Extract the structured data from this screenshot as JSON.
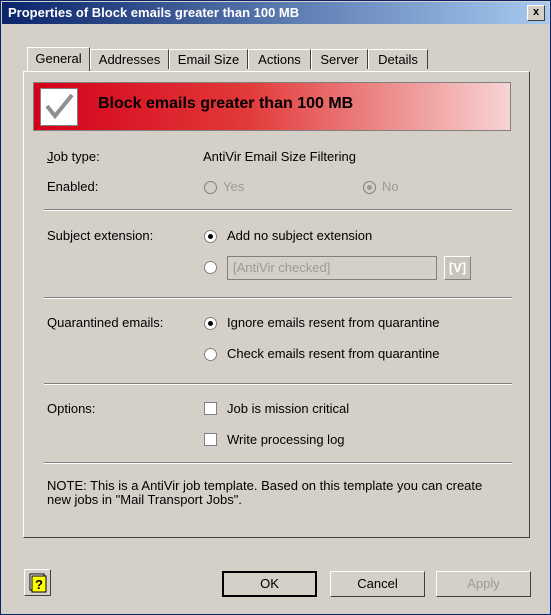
{
  "window": {
    "title": "Properties of Block emails greater than 100 MB",
    "close_glyph": "x"
  },
  "tabs": [
    {
      "label": "General",
      "active": true
    },
    {
      "label": "Addresses"
    },
    {
      "label": "Email Size"
    },
    {
      "label": "Actions"
    },
    {
      "label": "Server"
    },
    {
      "label": "Details"
    }
  ],
  "banner": {
    "title": "Block emails greater than 100 MB",
    "gradient_start": "#d4001a",
    "gradient_end": "#f7d4d4",
    "icon": "check-icon"
  },
  "job_type": {
    "label": "Job type:",
    "value": "AntiVir Email Size Filtering"
  },
  "enabled": {
    "label": "Enabled:",
    "yes": "Yes",
    "no": "No",
    "selected": "No"
  },
  "subject_extension": {
    "label": "Subject extension:",
    "option_none": "Add no subject extension",
    "text_value": "[AntiVir checked]",
    "button": "[V]",
    "selected": "none"
  },
  "quarantined": {
    "label": "Quarantined emails:",
    "option_ignore": "Ignore emails resent from quarantine",
    "option_check": "Check emails resent from quarantine",
    "selected": "ignore"
  },
  "options": {
    "label": "Options:",
    "mission_critical": "Job is mission critical",
    "processing_log": "Write processing log"
  },
  "note": "NOTE: This is a AntiVir job template. Based on this template you can create new jobs in \"Mail Transport Jobs\".",
  "buttons": {
    "ok": "OK",
    "cancel": "Cancel",
    "apply": "Apply",
    "help_icon": "help-icon"
  }
}
